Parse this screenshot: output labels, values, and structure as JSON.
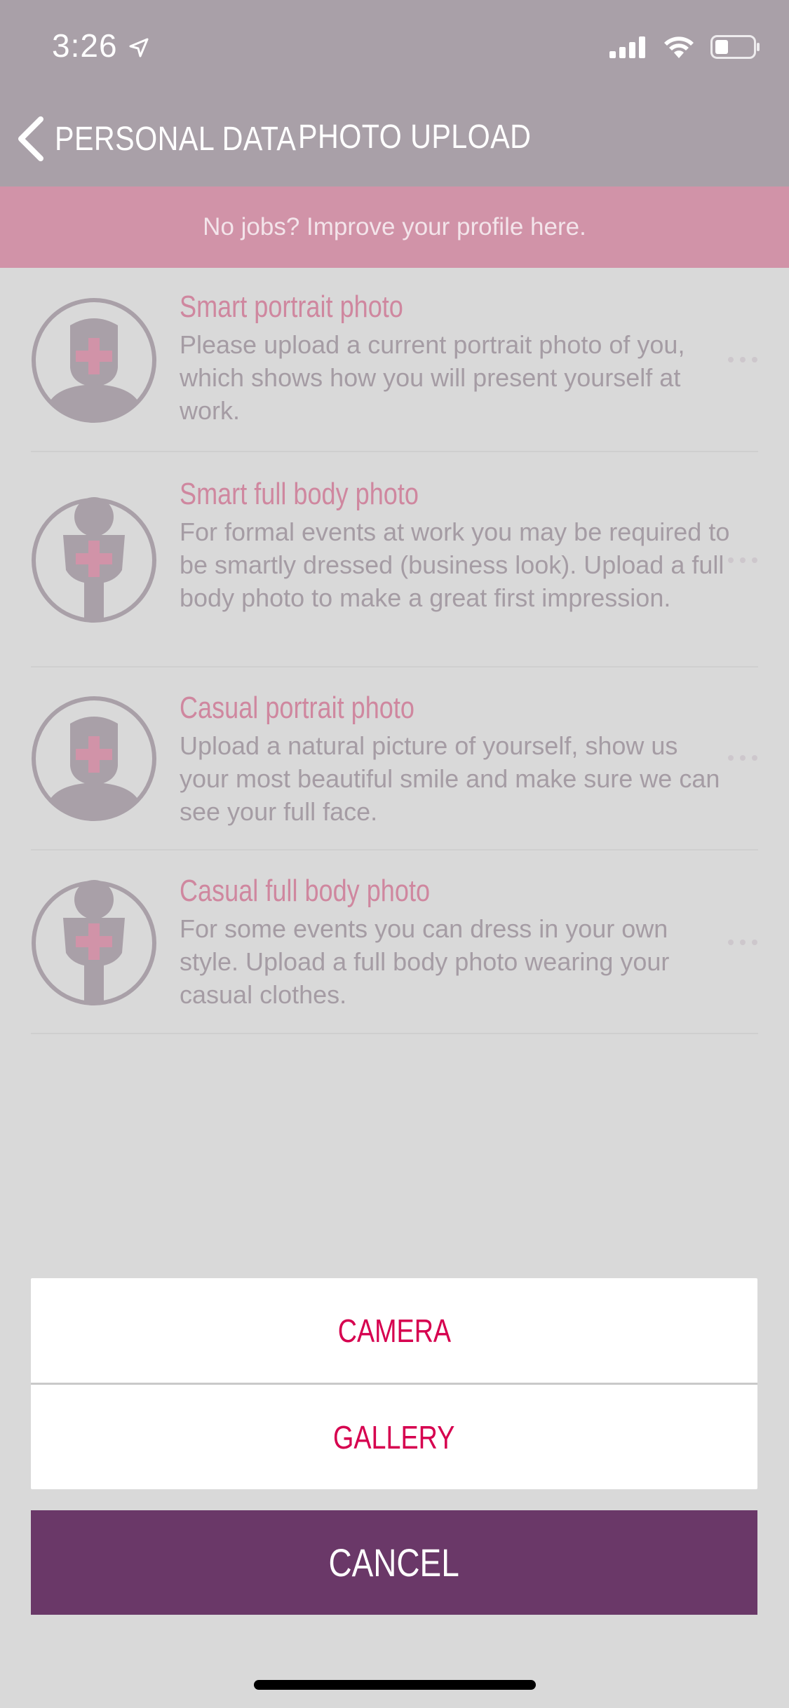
{
  "status_bar": {
    "time": "3:26",
    "icons": [
      "location-arrow-icon",
      "signal-icon",
      "wifi-icon",
      "battery-icon"
    ]
  },
  "nav": {
    "back_label": "PERSONAL DATA",
    "title": "PHOTO UPLOAD"
  },
  "banner": {
    "text": "No jobs? Improve your profile here."
  },
  "photos": [
    {
      "title": "Smart portrait photo",
      "description": "Please upload a current portrait photo of you, which shows how you will present yourself at work.",
      "icon": "portrait-add-icon"
    },
    {
      "title": "Smart full body photo",
      "description": "For formal events at work you may be required to be smartly dressed (business look). Upload a full body photo to make a great first impression.",
      "icon": "full-body-add-icon"
    },
    {
      "title": "Casual portrait photo",
      "description": "Upload a natural picture of yourself, show us your most beautiful smile and make sure we can see your full face.",
      "icon": "portrait-add-icon"
    },
    {
      "title": "Casual full body photo",
      "description": "For some events you can dress in your own style. Upload a full body photo wearing your casual clothes.",
      "icon": "full-body-add-icon"
    }
  ],
  "action_sheet": {
    "camera_label": "CAMERA",
    "gallery_label": "GALLERY",
    "cancel_label": "CANCEL"
  },
  "colors": {
    "header_bg": "#a9a0a8",
    "banner_bg": "#d193a8",
    "accent": "#d6004f",
    "cancel_bg": "#6a3868",
    "title_pink": "#cf879f"
  }
}
